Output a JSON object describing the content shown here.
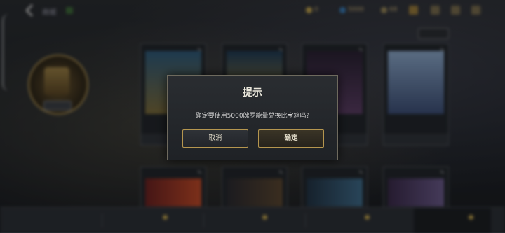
{
  "topbar": {
    "title": "商城",
    "currencies": [
      {
        "value": "0",
        "color": "#c9a94f",
        "icon": "coin-icon"
      },
      {
        "value": "5000",
        "color": "#3a7db8",
        "icon": "diamond-icon"
      },
      {
        "value": "68",
        "color": "#9b8a5a",
        "icon": "ticket-icon"
      }
    ]
  },
  "left_panel": {
    "subtitle": "",
    "name": "",
    "description": "",
    "footer": ""
  },
  "filter": {
    "label": ""
  },
  "cards": [
    {
      "label": "",
      "price": "",
      "art_color": "#3f6b8a"
    },
    {
      "label": "",
      "price": "",
      "art_color": "#b08b3c"
    },
    {
      "label": "",
      "price": "",
      "art_color": "#463a52"
    },
    {
      "label": "",
      "price": "",
      "art_color": "#5a7aa6"
    }
  ],
  "bottom_tabs": [
    "",
    "",
    "",
    "",
    ""
  ],
  "modal": {
    "title": "提示",
    "message": "确定要使用5000魄罗能量兑换此宝箱吗?",
    "cancel_label": "取消",
    "confirm_label": "确定"
  }
}
